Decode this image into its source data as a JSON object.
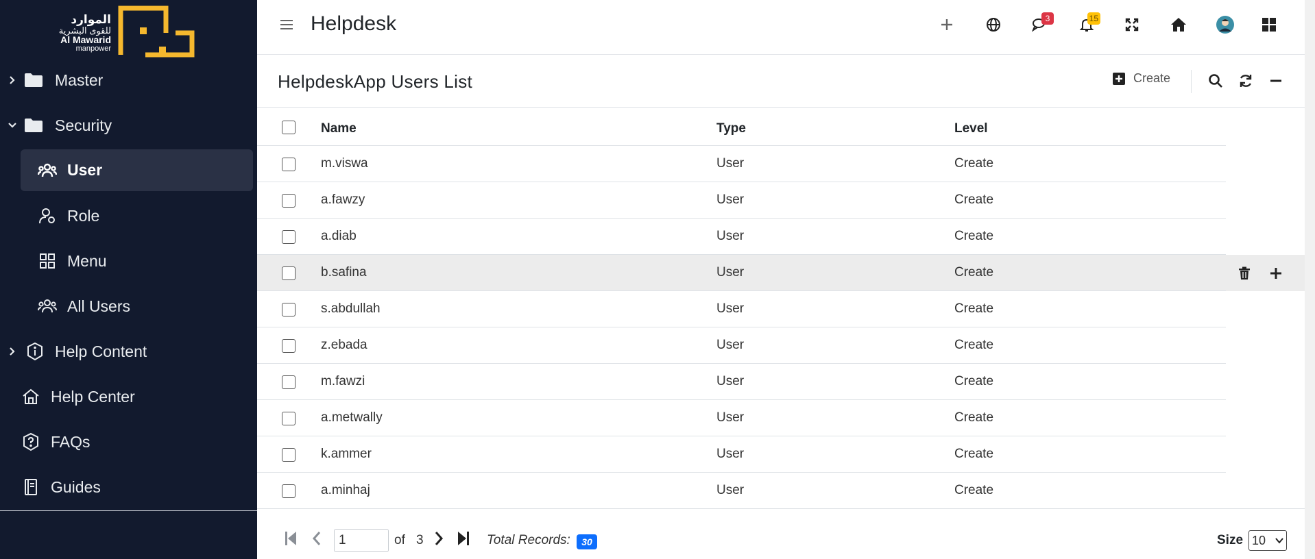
{
  "logo": {
    "arabic_line1": "الموارد",
    "arabic_line2": "للقوى البشرية",
    "english_line1": "Al Mawarid",
    "english_line2": "manpower",
    "brand_color": "#f5b82e"
  },
  "sidebar": {
    "items": [
      {
        "label": "Master",
        "icon": "folder-icon",
        "chevron": "right"
      },
      {
        "label": "Security",
        "icon": "folder-icon",
        "chevron": "down"
      },
      {
        "label": "User",
        "icon": "users-icon",
        "active": true
      },
      {
        "label": "Role",
        "icon": "user-gear-icon"
      },
      {
        "label": "Menu",
        "icon": "grid-icon"
      },
      {
        "label": "All Users",
        "icon": "users-icon"
      },
      {
        "label": "Help Content",
        "icon": "info-badge-icon",
        "chevron": "right"
      },
      {
        "label": "Help Center",
        "icon": "home-icon"
      },
      {
        "label": "FAQs",
        "icon": "question-badge-icon"
      },
      {
        "label": "Guides",
        "icon": "book-icon"
      }
    ]
  },
  "topbar": {
    "title": "Helpdesk",
    "messages_count": "3",
    "notifications_count": "15"
  },
  "card": {
    "title": "HelpdeskApp Users List",
    "create_label": "Create"
  },
  "table": {
    "columns": [
      "Name",
      "Type",
      "Level"
    ],
    "rows": [
      {
        "name": "m.viswa",
        "type": "User",
        "level": "Create"
      },
      {
        "name": "a.fawzy",
        "type": "User",
        "level": "Create"
      },
      {
        "name": "a.diab",
        "type": "User",
        "level": "Create"
      },
      {
        "name": "b.safina",
        "type": "User",
        "level": "Create"
      },
      {
        "name": "s.abdullah",
        "type": "User",
        "level": "Create"
      },
      {
        "name": "z.ebada",
        "type": "User",
        "level": "Create"
      },
      {
        "name": "m.fawzi",
        "type": "User",
        "level": "Create"
      },
      {
        "name": "a.metwally",
        "type": "User",
        "level": "Create"
      },
      {
        "name": "k.ammer",
        "type": "User",
        "level": "Create"
      },
      {
        "name": "a.minhaj",
        "type": "User",
        "level": "Create"
      }
    ]
  },
  "pager": {
    "current_page": "1",
    "of_label": "of",
    "total_pages": "3",
    "total_label": "Total Records:",
    "total_records": "30",
    "size_label": "Size",
    "size_value": "10"
  },
  "colors": {
    "sidebar_bg": "#121a2e",
    "active_item_bg": "#2a3145",
    "badge_red": "#dc3545",
    "badge_yellow": "#ffc107",
    "total_badge": "#0d6efd",
    "hover_row": "#ececec"
  }
}
